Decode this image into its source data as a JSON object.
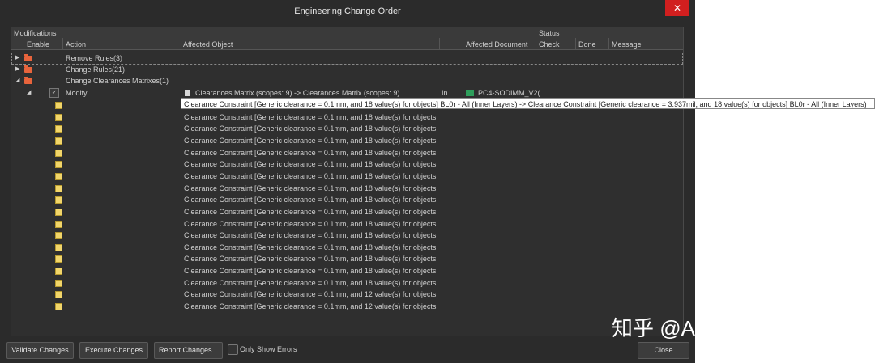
{
  "window": {
    "title": "Engineering Change Order",
    "close_glyph": "✕"
  },
  "headers": {
    "modifications": "Modifications",
    "status": "Status",
    "enable": "Enable",
    "action": "Action",
    "affected_object": "Affected Object",
    "affected_document": "Affected Document",
    "check": "Check",
    "done": "Done",
    "message": "Message"
  },
  "groups": [
    {
      "label": "Remove Rules(3)",
      "expanded": false
    },
    {
      "label": "Change Rules(21)",
      "expanded": false
    },
    {
      "label": "Change Clearances Matrixes(1)",
      "expanded": true
    }
  ],
  "modify_row": {
    "action": "Modify",
    "object": "Clearances Matrix (scopes: 9) -> Clearances Matrix (scopes: 9)",
    "in": "In",
    "document": "PC4-SODIMM_V2("
  },
  "tooltip": "Clearance Constraint [Generic clearance = 0.1mm, and 18 value(s) for objects] BL0r - All (Inner Layers) -> Clearance Constraint [Generic clearance = 3.937mil, and 18 value(s) for objects] BL0r - All (Inner Layers)",
  "constraint_rows": [
    "Clearance Constraint [Generic clearance = 0.1mm, and 18 value(s) for objects",
    "Clearance Constraint [Generic clearance = 0.1mm, and 18 value(s) for objects",
    "Clearance Constraint [Generic clearance = 0.1mm, and 18 value(s) for objects",
    "Clearance Constraint [Generic clearance = 0.1mm, and 18 value(s) for objects",
    "Clearance Constraint [Generic clearance = 0.1mm, and 18 value(s) for objects",
    "Clearance Constraint [Generic clearance = 0.1mm, and 18 value(s) for objects",
    "Clearance Constraint [Generic clearance = 0.1mm, and 18 value(s) for objects",
    "Clearance Constraint [Generic clearance = 0.1mm, and 18 value(s) for objects",
    "Clearance Constraint [Generic clearance = 0.1mm, and 18 value(s) for objects",
    "Clearance Constraint [Generic clearance = 0.1mm, and 18 value(s) for objects",
    "Clearance Constraint [Generic clearance = 0.1mm, and 18 value(s) for objects",
    "Clearance Constraint [Generic clearance = 0.1mm, and 18 value(s) for objects",
    "Clearance Constraint [Generic clearance = 0.1mm, and 18 value(s) for objects",
    "Clearance Constraint [Generic clearance = 0.1mm, and 18 value(s) for objects",
    "Clearance Constraint [Generic clearance = 0.1mm, and 18 value(s) for objects",
    "Clearance Constraint [Generic clearance = 0.1mm, and 18 value(s) for objects",
    "Clearance Constraint [Generic clearance = 0.1mm, and 12 value(s) for objects",
    "Clearance Constraint [Generic clearance = 0.1mm, and 12 value(s) for objects"
  ],
  "buttons": {
    "validate": "Validate Changes",
    "execute": "Execute Changes",
    "report": "Report Changes...",
    "only_errors": "Only Show Errors",
    "close": "Close"
  },
  "watermark": "知乎 @Altium China",
  "colors": {
    "window_bg": "#2b2b2b",
    "folder": "#e8643c",
    "close_button": "#d11f1f",
    "constraint_icon": "#f2d66a"
  }
}
